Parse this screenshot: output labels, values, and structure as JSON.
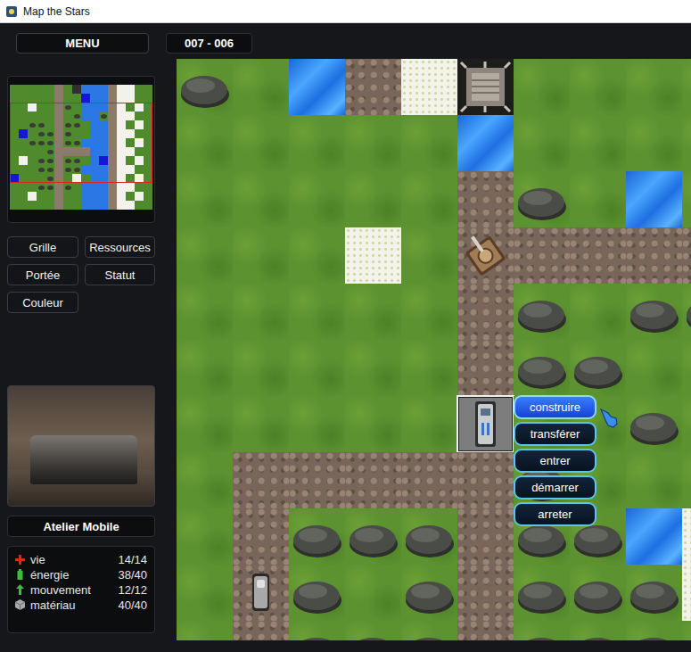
{
  "window": {
    "title": "Map the Stars"
  },
  "menu_button": "MENU",
  "coordinates": "007 - 006",
  "minimap": {
    "rows": [
      "gggggdgfwwwdssgg",
      "gggggdgguwwdssgg",
      "ggsggdrgwwwdsgsg",
      "gggggdgrwwrdssgg",
      "ggrrgdrrgwwdsgsg",
      "gugrrdrggwwdssgg",
      "ggrrrdrrwwwdsgsg",
      "ggggrddddwwdssgg",
      "gsgrrdrrgwudsgsg",
      "gggrrdrrwwwdssgg",
      "ugggrdgsgwwdsgsg",
      "gggrrdrgwwwdssgg",
      "ggsggdggwwwdsgsg",
      "gggggdggwwwdssgg"
    ],
    "viewport": {
      "col": 0,
      "row": 2,
      "cols": 16,
      "rows": 9
    }
  },
  "view_buttons": [
    "Grille",
    "Ressources",
    "Portée",
    "Statut",
    "Couleur"
  ],
  "unit": {
    "name": "Atelier Mobile",
    "stats": [
      {
        "kind": "health",
        "label": "vie",
        "value": "14/14"
      },
      {
        "kind": "energy",
        "label": "énergie",
        "value": "38/40"
      },
      {
        "kind": "movement",
        "label": "mouvement",
        "value": "12/12"
      },
      {
        "kind": "material",
        "label": "matériau",
        "value": "40/40"
      }
    ]
  },
  "map": {
    "rows": [
      [
        "rock",
        "grass",
        "water",
        "road",
        "sand",
        "fort",
        "grass",
        "grass",
        "grass",
        "grass"
      ],
      [
        "grass",
        "grass",
        "grass",
        "grass",
        "grass",
        "water",
        "grass",
        "grass",
        "grass",
        "grass"
      ],
      [
        "grass",
        "grass",
        "grass",
        "grass",
        "grass",
        "road",
        "rock",
        "grass",
        "water",
        "grass"
      ],
      [
        "grass",
        "grass",
        "grass",
        "sand",
        "grass",
        "tank",
        "road",
        "road",
        "road",
        "road"
      ],
      [
        "grass",
        "grass",
        "grass",
        "grass",
        "grass",
        "road",
        "rock",
        "grass",
        "rock",
        "rock"
      ],
      [
        "grass",
        "grass",
        "grass",
        "grass",
        "grass",
        "road",
        "rock",
        "rock",
        "grass",
        "grass"
      ],
      [
        "grass",
        "grass",
        "grass",
        "grass",
        "grass",
        "workshop",
        "grass",
        "grass",
        "rock",
        "grass"
      ],
      [
        "grass",
        "road",
        "road",
        "road",
        "road",
        "road",
        "rock",
        "grass",
        "grass",
        "grass"
      ],
      [
        "grass",
        "road",
        "rock",
        "rock",
        "rock",
        "road",
        "rock",
        "rock",
        "water",
        "sand"
      ],
      [
        "grass",
        "rover",
        "rock",
        "grass",
        "rock",
        "road",
        "rock",
        "rock",
        "rock",
        "sand"
      ],
      [
        "grass",
        "road",
        "rock",
        "rock",
        "rock",
        "road",
        "rock",
        "rock",
        "rock",
        "grass"
      ]
    ],
    "selection": {
      "row": 6,
      "col": 5
    }
  },
  "context_menu": [
    {
      "label": "construire",
      "selected": true
    },
    {
      "label": "transférer",
      "selected": false
    },
    {
      "label": "entrer",
      "selected": false
    },
    {
      "label": "démarrer",
      "selected": false
    },
    {
      "label": "arreter",
      "selected": false
    }
  ]
}
